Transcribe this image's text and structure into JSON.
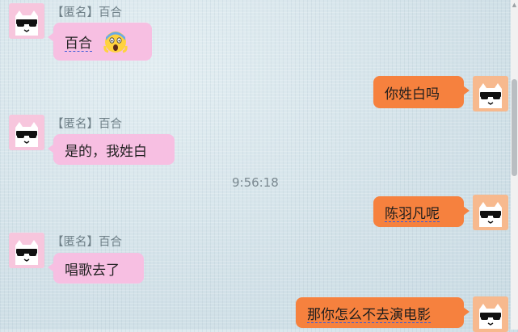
{
  "colors": {
    "incoming_bubble": "#f7bfe2",
    "outgoing_bubble": "#f6813e",
    "incoming_avatar": "#f7c6dd",
    "outgoing_avatar": "#f7b98e",
    "background": "#d6e4ea"
  },
  "messages": [
    {
      "sender": "【匿名】百合",
      "text": "百合",
      "emoji": "face-screaming-in-fear-emoji",
      "avatar_icon": "cat-with-sunglasses-icon",
      "direction": "incoming"
    },
    {
      "text": "你姓白吗",
      "avatar_icon": "cat-with-sunglasses-icon",
      "direction": "outgoing"
    },
    {
      "sender": "【匿名】百合",
      "text": "是的，我姓白",
      "avatar_icon": "cat-with-sunglasses-icon",
      "direction": "incoming"
    },
    {
      "timestamp": "9:56:18"
    },
    {
      "text": "陈羽凡呢",
      "avatar_icon": "cat-with-sunglasses-icon",
      "direction": "outgoing"
    },
    {
      "sender": "【匿名】百合",
      "text": "唱歌去了",
      "avatar_icon": "cat-with-sunglasses-icon",
      "direction": "incoming"
    },
    {
      "text": "那你怎么不去演电影",
      "avatar_icon": "cat-with-sunglasses-icon",
      "direction": "outgoing"
    }
  ],
  "scrollbar": {
    "up_arrow_icon": "scroll-up-arrow-icon"
  }
}
